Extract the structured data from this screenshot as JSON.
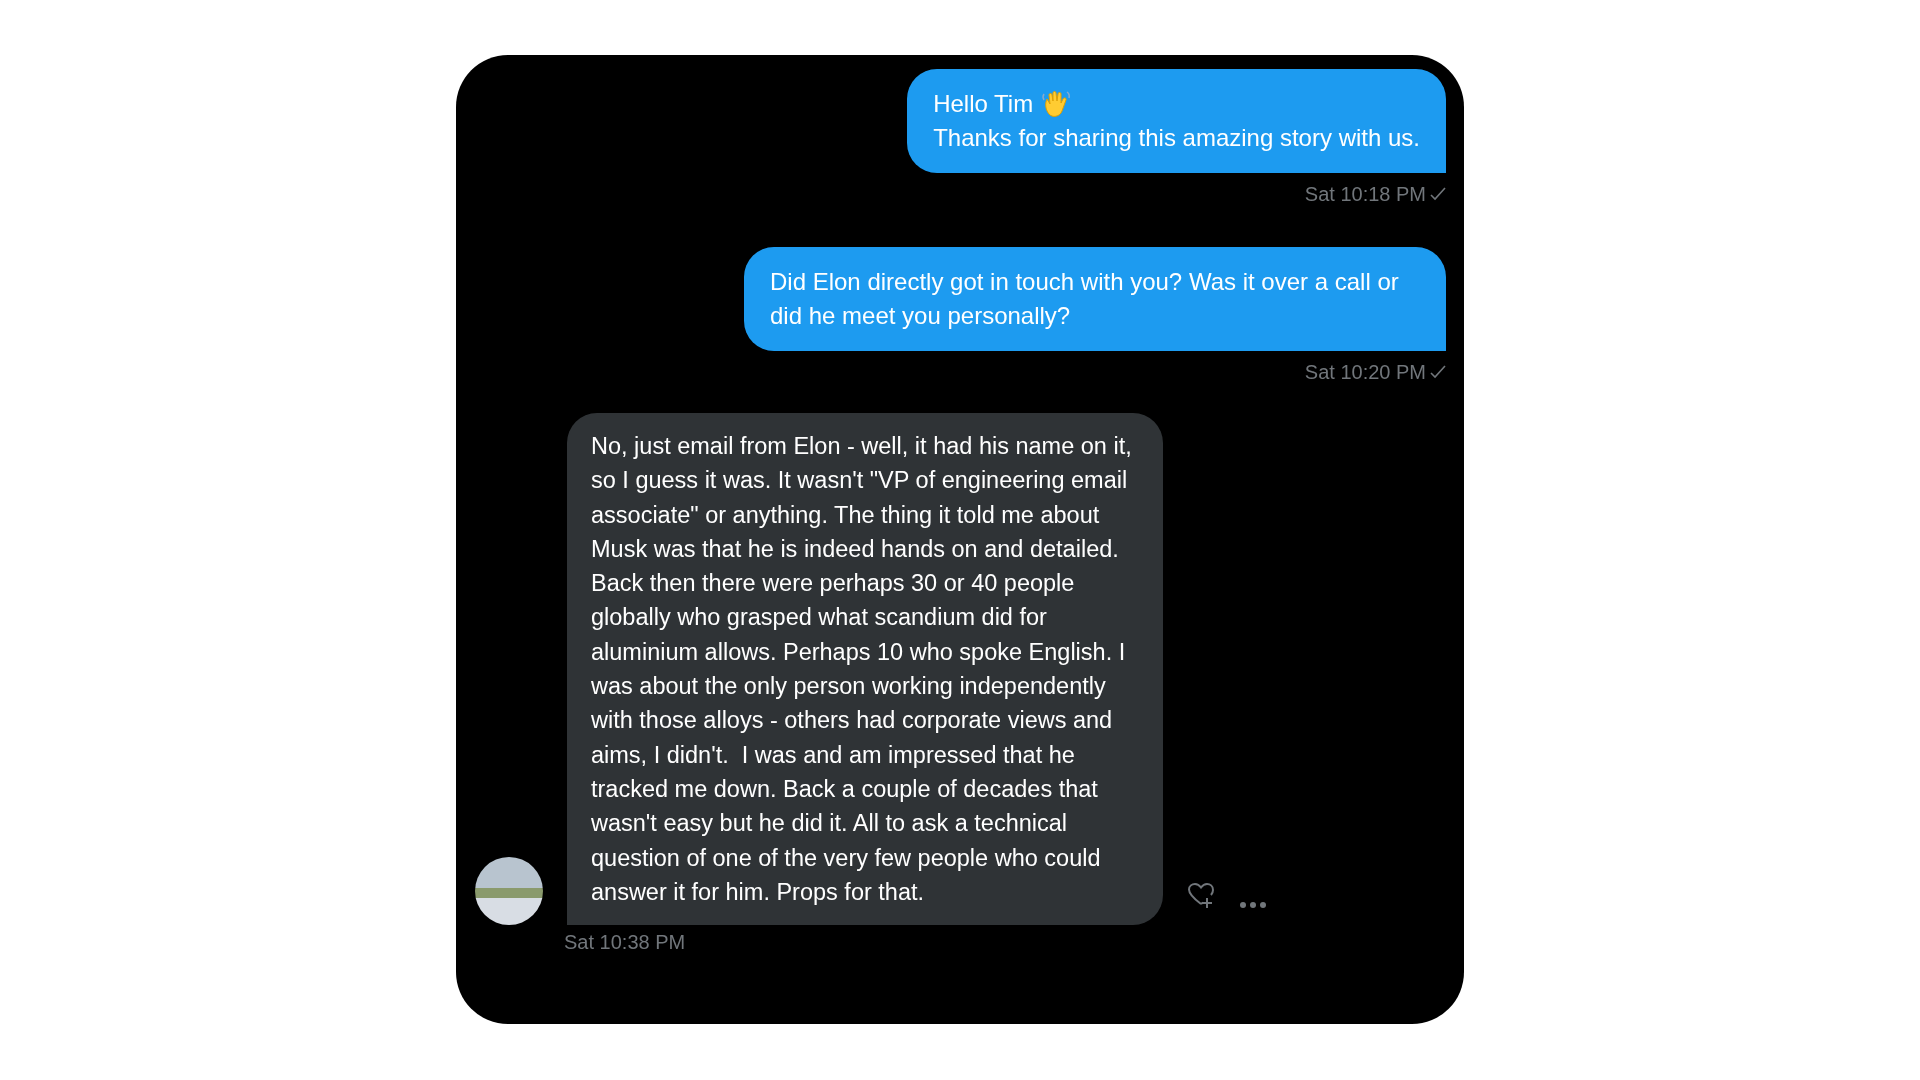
{
  "messages": [
    {
      "kind": "sent",
      "lines": [
        "Hello Tim",
        "Thanks for sharing this amazing story with us."
      ],
      "wave_emoji": true,
      "time": "Sat 10:18 PM",
      "delivered": true
    },
    {
      "kind": "sent",
      "lines": [
        "Did Elon directly got in touch with you? Was it over a call or did he meet you personally?"
      ],
      "time": "Sat 10:20 PM",
      "delivered": true
    },
    {
      "kind": "received",
      "lines": [
        "No, just email from Elon - well, it had his name on it, so I guess it was. It wasn't \"VP of engineering email associate\" or anything. The thing it told me about Musk was that he is indeed hands on and detailed. Back then there were perhaps 30 or 40 people globally who grasped what scandium did for aluminium allows. Perhaps 10 who spoke English. I was about the only person working independently with those alloys - others had corporate views and aims, I didn't.  I was and am impressed that he tracked me down. Back a couple of decades that wasn't easy but he did it. All to ask a technical question of one of the very few people who could answer it for him. Props for that."
      ],
      "time": "Sat 10:38 PM"
    }
  ]
}
